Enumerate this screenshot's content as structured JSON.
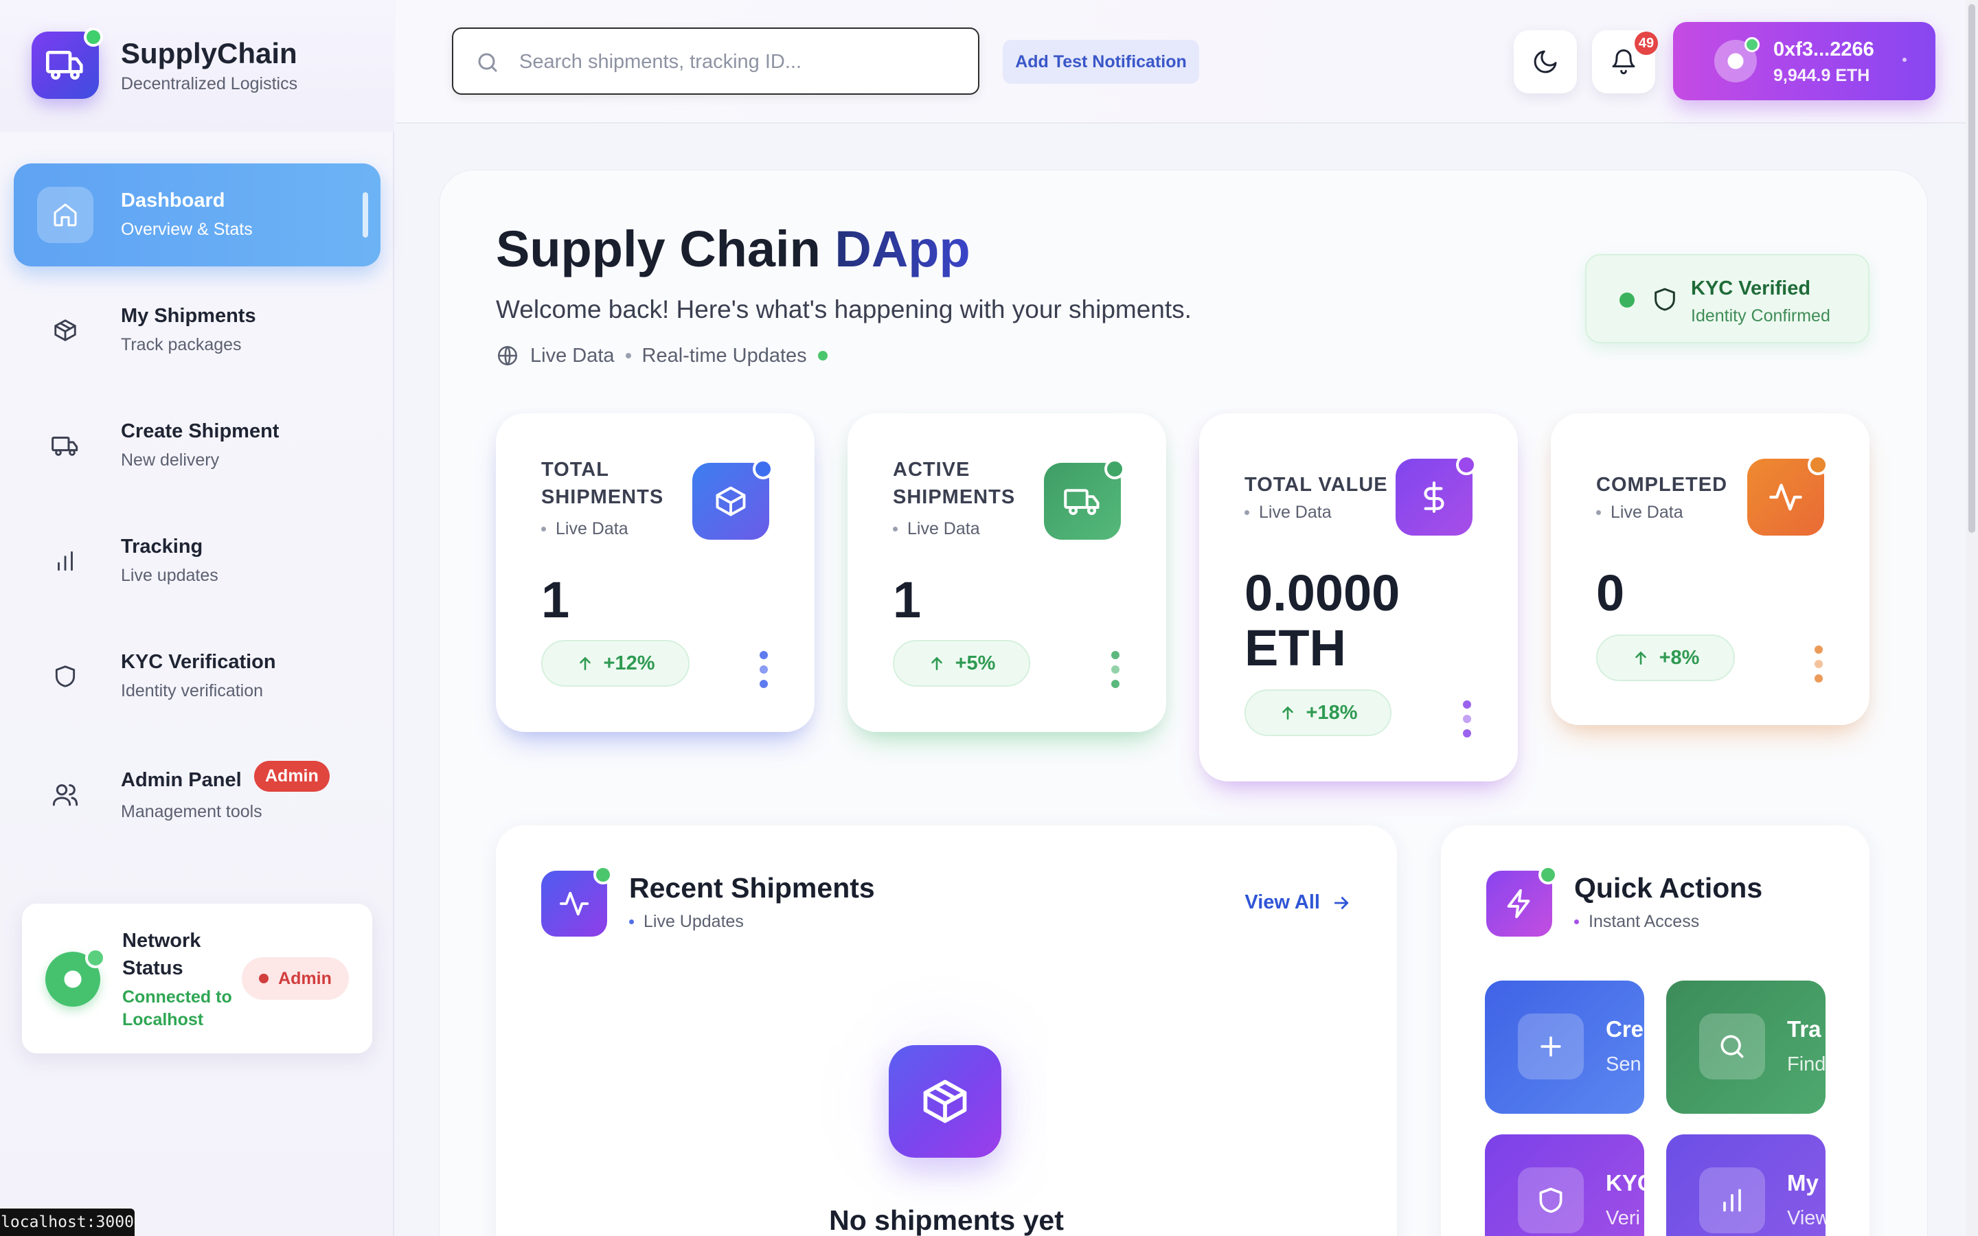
{
  "brand": {
    "title": "SupplyChain",
    "subtitle": "Decentralized Logistics"
  },
  "sidebar": {
    "items": [
      {
        "label": "Dashboard",
        "sub": "Overview & Stats",
        "icon": "home-icon",
        "active": true
      },
      {
        "label": "My Shipments",
        "sub": "Track packages",
        "icon": "package-icon"
      },
      {
        "label": "Create Shipment",
        "sub": "New delivery",
        "icon": "truck-icon"
      },
      {
        "label": "Tracking",
        "sub": "Live updates",
        "icon": "bar-chart-icon"
      },
      {
        "label": "KYC Verification",
        "sub": "Identity verification",
        "icon": "shield-icon"
      },
      {
        "label": "Admin Panel",
        "sub": "Management tools",
        "icon": "users-icon",
        "badge": "Admin"
      }
    ],
    "network": {
      "title": "Network Status",
      "status": "Connected to Localhost",
      "badge": "Admin"
    }
  },
  "header": {
    "search_placeholder": "Search shipments, tracking ID...",
    "add_notification": "Add Test Notification",
    "notification_count": "49",
    "wallet": {
      "address": "0xf3...2266",
      "balance": "9,944.9 ETH"
    }
  },
  "page": {
    "title_part1": "Supply Chain",
    "title_part2": "DApp",
    "subtitle": "Welcome back! Here's what's happening with your shipments.",
    "live_data": "Live Data",
    "realtime": "Real-time Updates"
  },
  "kyc": {
    "title": "KYC Verified",
    "subtitle": "Identity Confirmed"
  },
  "stats": [
    {
      "label": "TOTAL SHIPMENTS",
      "live": "Live Data",
      "value": "1",
      "change": "+12%",
      "icon": "package-icon",
      "color": "#4f6ee8"
    },
    {
      "label": "ACTIVE SHIPMENTS",
      "live": "Live Data",
      "value": "1",
      "change": "+5%",
      "icon": "truck-icon",
      "color": "#3fa667"
    },
    {
      "label": "TOTAL VALUE",
      "live": "Live Data",
      "value": "0.0000 ETH",
      "change": "+18%",
      "icon": "dollar-icon",
      "color": "#9b49ec"
    },
    {
      "label": "COMPLETED",
      "live": "Live Data",
      "value": "0",
      "change": "+8%",
      "icon": "activity-icon",
      "color": "#ec8a37"
    }
  ],
  "recent": {
    "title": "Recent Shipments",
    "subtitle": "Live Updates",
    "view_all": "View All",
    "empty": "No shipments yet"
  },
  "quick_actions": {
    "title": "Quick Actions",
    "subtitle": "Instant Access",
    "tiles": [
      {
        "title": "Cre",
        "sub": "Sen",
        "icon": "plus-icon"
      },
      {
        "title": "Tra",
        "sub": "Find",
        "icon": "search-icon"
      },
      {
        "title": "KYC",
        "sub": "Veri",
        "icon": "shield-icon"
      },
      {
        "title": "My",
        "sub": "View",
        "icon": "bar-chart-icon"
      }
    ]
  },
  "status_bar": "localhost:3000"
}
